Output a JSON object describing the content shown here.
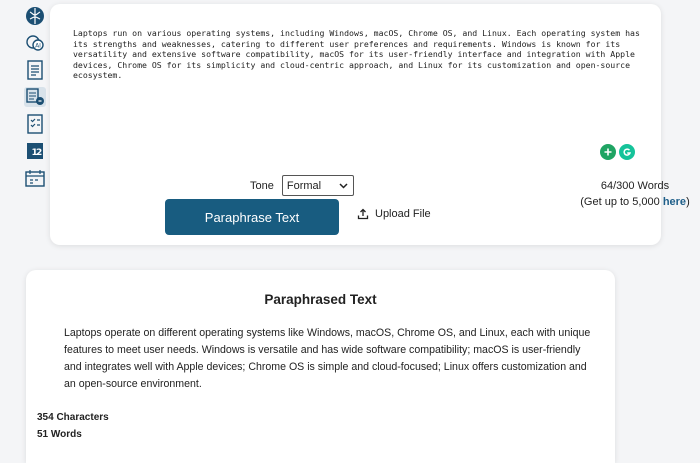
{
  "sidebar": {
    "icons": [
      "brain-logo-icon",
      "chat-bubbles-icon",
      "document-icon",
      "paraphrase-tool-icon",
      "checklist-icon",
      "number-grid-icon",
      "calendar-icon"
    ]
  },
  "input": {
    "text": "Laptops run on various operating systems, including Windows, macOS, Chrome OS, and Linux. Each operating system has its strengths and weaknesses, catering to different user preferences and requirements. Windows is known for its versatility and extensive software compatibility, macOS for its user-friendly interface and integration with Apple devices, Chrome OS for its simplicity and cloud-centric approach, and Linux for its customization and open-source ecosystem."
  },
  "tone": {
    "label": "Tone",
    "selected": "Formal"
  },
  "word_count": {
    "count": "64/300 Words",
    "upsell_prefix": "(Get up to 5,000 ",
    "upsell_link": "here",
    "upsell_suffix": ")"
  },
  "actions": {
    "paraphrase_label": "Paraphrase Text",
    "upload_label": "Upload File"
  },
  "output": {
    "title": "Paraphrased Text",
    "text": "Laptops operate on different operating systems like Windows, macOS, Chrome OS, and Linux, each with unique features to meet user needs. Windows is versatile and has wide software compatibility; macOS is user-friendly and integrates well with Apple devices; Chrome OS is simple and cloud-focused; Linux offers customization and an open-source environment.",
    "characters": "354 Characters",
    "words": "51 Words"
  },
  "colors": {
    "primary_button": "#185c80",
    "link": "#1f5f8a"
  }
}
